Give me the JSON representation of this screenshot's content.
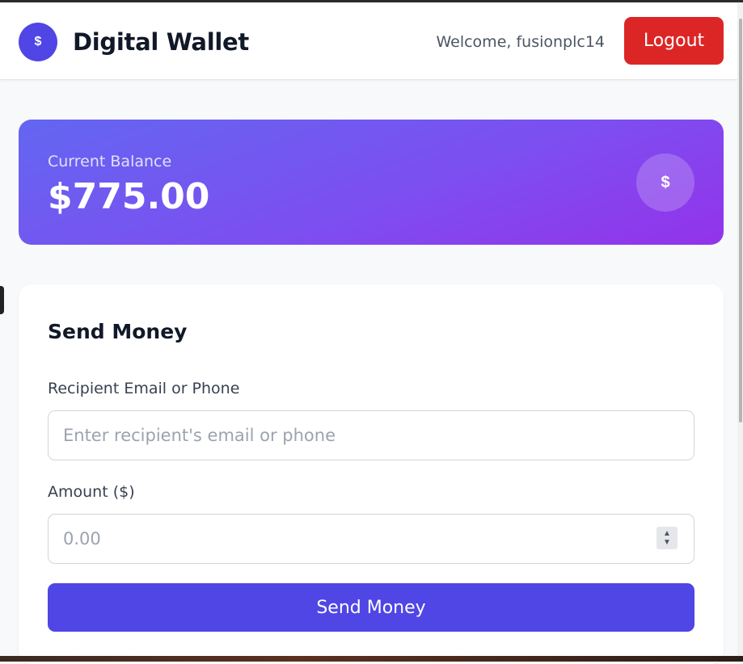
{
  "header": {
    "logo_symbol": "$",
    "title": "Digital Wallet",
    "welcome_text": "Welcome, fusionplc14",
    "logout_label": "Logout"
  },
  "balance": {
    "label": "Current Balance",
    "amount": "$775.00",
    "icon_symbol": "$"
  },
  "send_money": {
    "title": "Send Money",
    "recipient_label": "Recipient Email or Phone",
    "recipient_placeholder": "Enter recipient's email or phone",
    "recipient_value": "",
    "amount_label": "Amount ($)",
    "amount_placeholder": "0.00",
    "amount_value": "",
    "submit_label": "Send Money"
  },
  "colors": {
    "primary": "#4f46e5",
    "danger": "#dc2626",
    "gradient_start": "#6366f1",
    "gradient_end": "#9333ea"
  },
  "icons": {
    "logo": "dollar-icon",
    "balance": "dollar-icon",
    "spinner": "stepper-arrows-icon"
  }
}
